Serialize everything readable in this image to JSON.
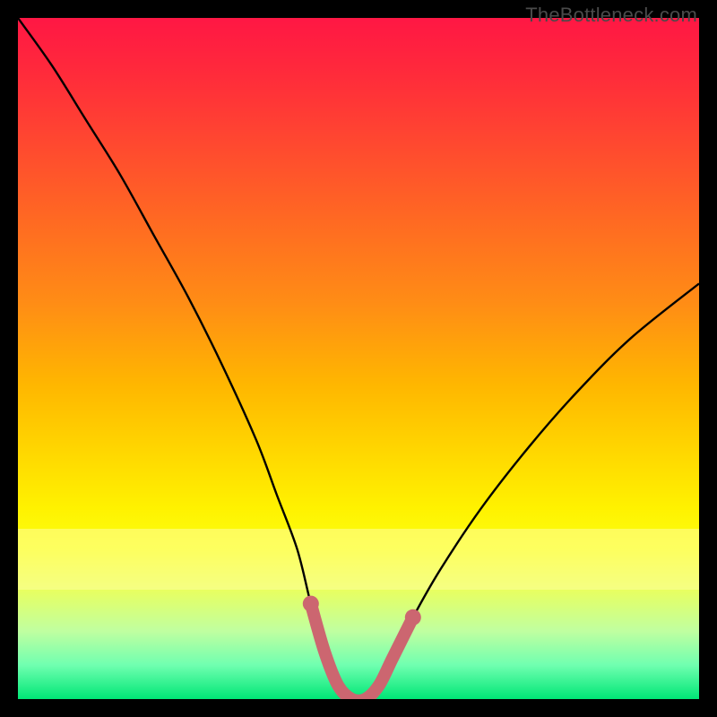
{
  "watermark": "TheBottleneck.com",
  "colors": {
    "frame_bg": "#000000",
    "curve": "#000000",
    "highlight": "#cc6670",
    "highlight_dot": "#cc6670"
  },
  "chart_data": {
    "type": "line",
    "title": "",
    "xlabel": "",
    "ylabel": "",
    "xlim": [
      0,
      100
    ],
    "ylim": [
      0,
      100
    ],
    "grid": false,
    "series": [
      {
        "name": "bottleneck-curve",
        "x": [
          0,
          5,
          10,
          15,
          20,
          25,
          30,
          35,
          38,
          41,
          43,
          45,
          47,
          49,
          51,
          53,
          55,
          58,
          62,
          68,
          75,
          82,
          90,
          100
        ],
        "y": [
          100,
          93,
          85,
          77,
          68,
          59,
          49,
          38,
          30,
          22,
          14,
          7,
          2,
          0,
          0,
          2,
          6,
          12,
          19,
          28,
          37,
          45,
          53,
          61
        ]
      }
    ],
    "highlight_band": {
      "y_min": 0,
      "y_max": 9
    },
    "yellow_band": {
      "start_pct": 75,
      "height_pct": 9
    }
  }
}
